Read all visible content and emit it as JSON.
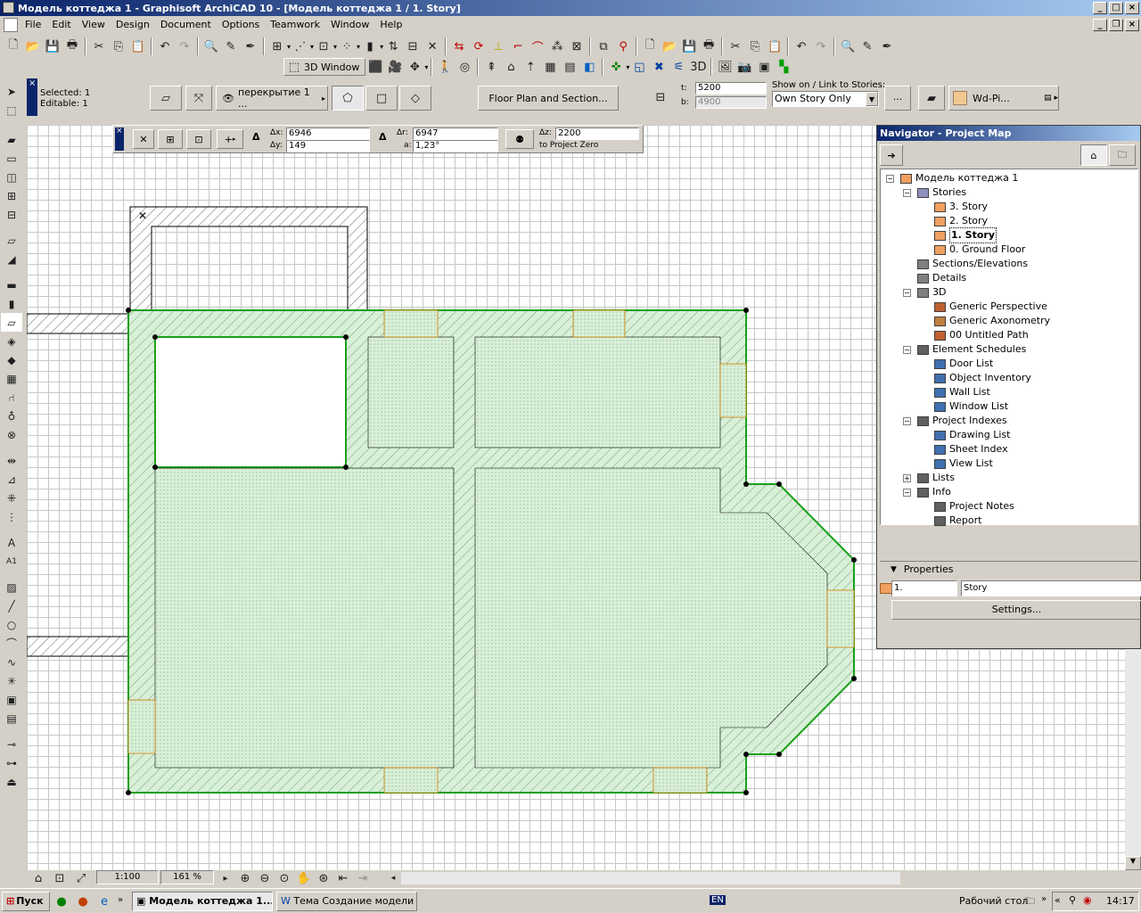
{
  "window": {
    "title": "Модель коттеджа 1 - Graphisoft ArchiCAD 10 - [Модель коттеджа 1 / 1. Story]"
  },
  "menu": [
    "File",
    "Edit",
    "View",
    "Design",
    "Document",
    "Options",
    "Teamwork",
    "Window",
    "Help"
  ],
  "toolbar2": {
    "three_d_window": "3D Window"
  },
  "infobox": {
    "selected": "Selected: 1",
    "editable": "Editable: 1",
    "layer": "перекрытие 1 ...",
    "floor_plan_section": "Floor Plan and Section...",
    "top_label": "t:",
    "top_value": "5200",
    "bottom_label": "b:",
    "bottom_value": "4900",
    "show_on_label": "Show on / Link to Stories:",
    "show_on_value": "Own Story Only",
    "more_button": "...",
    "material": "Wd-Pi..."
  },
  "coords": {
    "dx_label": "Δx:",
    "dx": "6946",
    "dy_label": "Δy:",
    "dy": "149",
    "dr_label": "Δr:",
    "dr": "6947",
    "a_label": "a:",
    "a": "1,23°",
    "dz_label": "Δz:",
    "dz": "2200",
    "reference": "to Project Zero"
  },
  "navigator": {
    "title": "Navigator - Project Map",
    "tree": [
      {
        "label": "Модель коттеджа 1",
        "level": 0,
        "icon": "project-icon"
      },
      {
        "label": "Stories",
        "level": 1,
        "icon": "stories-icon"
      },
      {
        "label": "3. Story",
        "level": 2,
        "icon": "story-icon"
      },
      {
        "label": "2. Story",
        "level": 2,
        "icon": "story-icon"
      },
      {
        "label": "1. Story",
        "level": 2,
        "icon": "story-icon",
        "selected": true
      },
      {
        "label": "0. Ground Floor",
        "level": 2,
        "icon": "story-icon"
      },
      {
        "label": "Sections/Elevations",
        "level": 1,
        "icon": "section-icon"
      },
      {
        "label": "Details",
        "level": 1,
        "icon": "details-icon"
      },
      {
        "label": "3D",
        "level": 1,
        "icon": "3d-icon"
      },
      {
        "label": "Generic Perspective",
        "level": 2,
        "icon": "camera-icon"
      },
      {
        "label": "Generic Axonometry",
        "level": 2,
        "icon": "axonometry-icon"
      },
      {
        "label": "00 Untitled Path",
        "level": 2,
        "icon": "path-icon"
      },
      {
        "label": "Element Schedules",
        "level": 1,
        "icon": "schedule-icon"
      },
      {
        "label": "Door List",
        "level": 2,
        "icon": "list-icon"
      },
      {
        "label": "Object Inventory",
        "level": 2,
        "icon": "list-icon"
      },
      {
        "label": "Wall List",
        "level": 2,
        "icon": "list-icon"
      },
      {
        "label": "Window List",
        "level": 2,
        "icon": "list-icon"
      },
      {
        "label": "Project Indexes",
        "level": 1,
        "icon": "index-icon"
      },
      {
        "label": "Drawing List",
        "level": 2,
        "icon": "list-icon"
      },
      {
        "label": "Sheet Index",
        "level": 2,
        "icon": "list-icon"
      },
      {
        "label": "View List",
        "level": 2,
        "icon": "list-icon"
      },
      {
        "label": "Lists",
        "level": 1,
        "icon": "lists-icon"
      },
      {
        "label": "Info",
        "level": 1,
        "icon": "info-icon"
      },
      {
        "label": "Project Notes",
        "level": 2,
        "icon": "notes-icon"
      },
      {
        "label": "Report",
        "level": 2,
        "icon": "report-icon"
      }
    ],
    "properties_label": "Properties",
    "prop_id": "1.",
    "prop_name": "Story",
    "settings_button": "Settings..."
  },
  "status": {
    "scale": "1:100",
    "zoom": "161 %"
  },
  "taskbar": {
    "start": "Пуск",
    "task1": "Модель коттеджа 1...",
    "task2": "Тема Создание модели ...",
    "lang": "EN",
    "desktop": "Рабочий стол",
    "clock": "14:17"
  },
  "colors": {
    "slab_fill": "#d8efd8",
    "slab_outline": "#1aa01a",
    "titlebar": "#0a246a"
  }
}
